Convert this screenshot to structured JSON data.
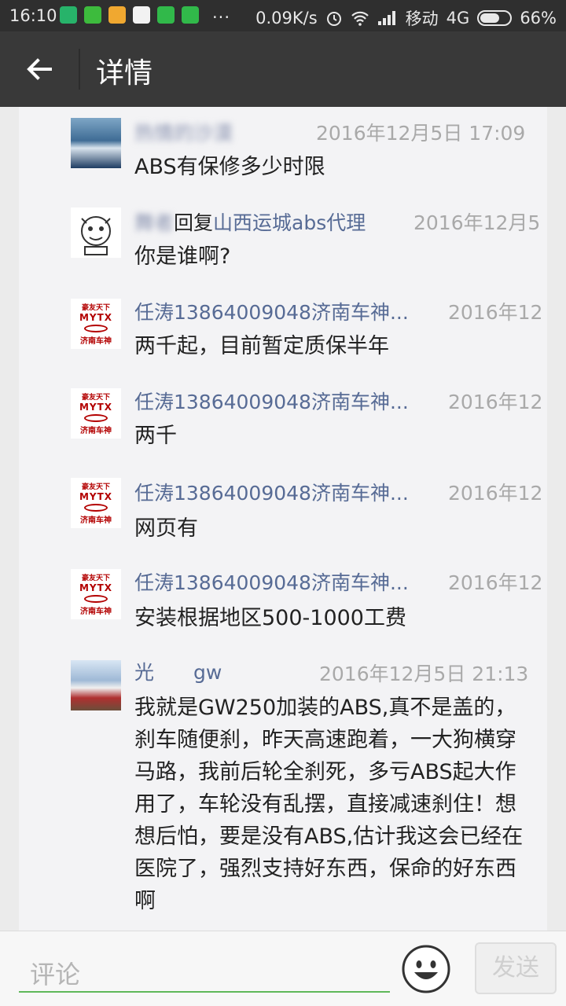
{
  "status_bar": {
    "time": "16:10",
    "dots": "...",
    "speed": "0.09K/s",
    "carrier": "移动",
    "network": "4G",
    "battery": "66%",
    "battery_level": 0.66
  },
  "header": {
    "title": "详情"
  },
  "comments": [
    {
      "name": "热情的沙漠",
      "reply_word": "",
      "reply_to": "",
      "time": "2016年12月5日 17:09",
      "text": "ABS有保修多少时限"
    },
    {
      "name": "舞者",
      "reply_word": "回复",
      "reply_to": "山西运城abs代理",
      "time": "2016年12月5",
      "text": "你是谁啊?"
    },
    {
      "name": "任涛13864009048济南车神...",
      "reply_word": "",
      "reply_to": "",
      "time": "2016年12",
      "text": "两千起，目前暂定质保半年"
    },
    {
      "name": "任涛13864009048济南车神...",
      "reply_word": "",
      "reply_to": "",
      "time": "2016年12",
      "text": "两千"
    },
    {
      "name": "任涛13864009048济南车神...",
      "reply_word": "",
      "reply_to": "",
      "time": "2016年12",
      "text": "网页有"
    },
    {
      "name": "任涛13864009048济南车神...",
      "reply_word": "",
      "reply_to": "",
      "time": "2016年12",
      "text": "安装根据地区500-1000工费"
    },
    {
      "name": "光",
      "name_suffix": "gw",
      "reply_word": "",
      "reply_to": "",
      "time": "2016年12月5日 21:13",
      "text": "我就是GW250加装的ABS,真不是盖的，刹车随便刹，昨天高速跑着，一大狗横穿马路，我前后轮全刹死，多亏ABS起大作用了，车轮没有乱摆，直接减速刹住！想想后怕，要是没有ABS,估计我这会已经在医院了，强烈支持好东西，保命的好东西啊"
    }
  ],
  "mytx_logo": {
    "line1": "豪友天下",
    "line2": "MYTX",
    "line3": "济南车神"
  },
  "footer": {
    "placeholder": "评论",
    "send_label": "发送"
  }
}
